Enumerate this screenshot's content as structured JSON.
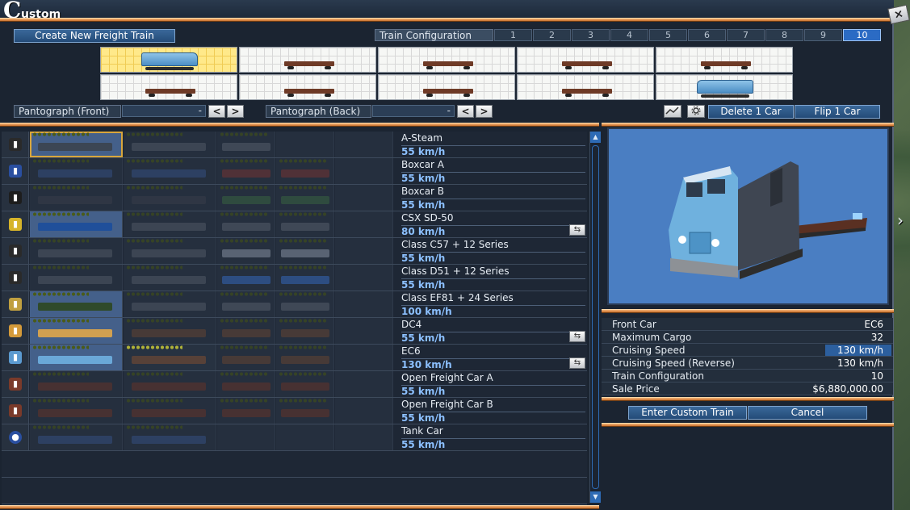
{
  "window": {
    "title_initial": "C",
    "title_rest": "ustom",
    "close_label": "×"
  },
  "toolbar": {
    "create_label": "Create New Freight Train",
    "config_label": "Train Configuration",
    "config_numbers": [
      "1",
      "2",
      "3",
      "4",
      "5",
      "6",
      "7",
      "8",
      "9",
      "10"
    ],
    "selected_config": "10"
  },
  "pantograph": {
    "front_label": "Pantograph (Front)",
    "front_value": "-",
    "back_label": "Pantograph (Back)",
    "back_value": "-",
    "prev": "<",
    "next": ">"
  },
  "actions": {
    "delete_label": "Delete 1 Car",
    "flip_label": "Flip 1 Car"
  },
  "list_rows": [
    {
      "name": "A-Steam",
      "speed": "55 km/h"
    },
    {
      "name": "Boxcar A",
      "speed": "55 km/h"
    },
    {
      "name": "Boxcar B",
      "speed": "55 km/h"
    },
    {
      "name": "CSX SD-50",
      "speed": "80 km/h"
    },
    {
      "name": "Class C57 + 12 Series",
      "speed": "55 km/h"
    },
    {
      "name": "Class D51 + 12 Series",
      "speed": "55 km/h"
    },
    {
      "name": "Class EF81 + 24 Series",
      "speed": "100 km/h"
    },
    {
      "name": "DC4",
      "speed": "55 km/h"
    },
    {
      "name": "EC6",
      "speed": "130 km/h"
    },
    {
      "name": "Open Freight Car A",
      "speed": "55 km/h"
    },
    {
      "name": "Open Freight Car B",
      "speed": "55 km/h"
    },
    {
      "name": "Tank Car",
      "speed": "55 km/h"
    }
  ],
  "info": {
    "front_car_label": "Front Car",
    "front_car": "EC6",
    "max_cargo_label": "Maximum Cargo",
    "max_cargo": "32",
    "cruise_label": "Cruising Speed",
    "cruise": "130 km/h",
    "cruise_rev_label": "Cruising Speed (Reverse)",
    "cruise_rev": "130 km/h",
    "config_label": "Train Configuration",
    "config": "10",
    "price_label": "Sale Price",
    "price": "$6,880,000.00"
  },
  "footer": {
    "enter_label": "Enter Custom Train",
    "cancel_label": "Cancel"
  },
  "colors": {
    "accent": "#2b6bc4",
    "orange_bar": "#e8964c",
    "speed_text": "#8cc0ff"
  }
}
